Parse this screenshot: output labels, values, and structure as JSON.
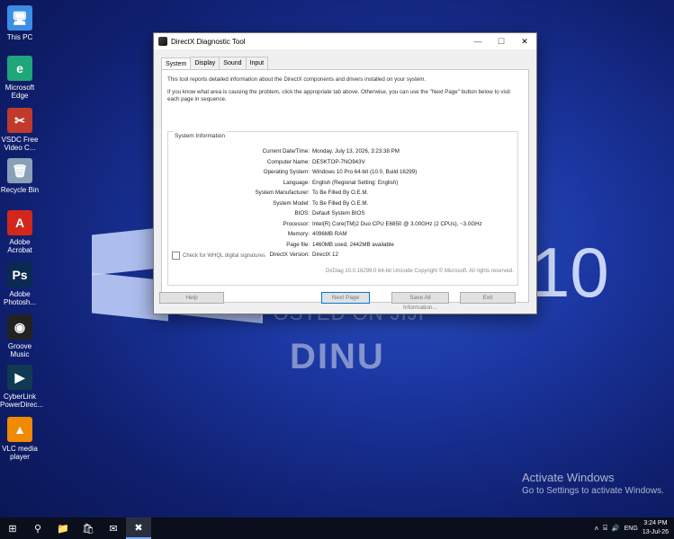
{
  "desktop": {
    "icons": [
      {
        "label": "This PC",
        "icon": "computer-icon",
        "glyph": "🖥",
        "color": "#3a8ee6"
      },
      {
        "label": "Microsoft Edge",
        "icon": "edge-icon",
        "glyph": "e",
        "color": "#1fa67a"
      },
      {
        "label": "VSDC Free Video C...",
        "icon": "vsdc-icon",
        "glyph": "✂",
        "color": "#c0392b"
      },
      {
        "label": "Recycle Bin",
        "icon": "recycle-bin-icon",
        "glyph": "🗑",
        "color": "#8aa0b8"
      },
      {
        "label": "Adobe Acrobat",
        "icon": "acrobat-icon",
        "glyph": "A",
        "color": "#d4271c"
      },
      {
        "label": "Adobe Photosh...",
        "icon": "photoshop-icon",
        "glyph": "Ps",
        "color": "#0a2a52"
      },
      {
        "label": "Groove Music",
        "icon": "groove-music-icon",
        "glyph": "◉",
        "color": "#222222"
      },
      {
        "label": "CyberLink PowerDirec...",
        "icon": "powerdirector-icon",
        "glyph": "▶",
        "color": "#0f3a52"
      },
      {
        "label": "VLC media player",
        "icon": "vlc-icon",
        "glyph": "▲",
        "color": "#f08a00"
      }
    ],
    "watermark_posted": "POSTED ON JIJI",
    "watermark_name": "DINU",
    "win10_number": "10",
    "activation_title": "Activate Windows",
    "activation_sub": "Go to Settings to activate Windows."
  },
  "window": {
    "title": "DirectX Diagnostic Tool",
    "controls": {
      "minimize": "—",
      "maximize": "☐",
      "close": "✕"
    },
    "tabs": [
      "System",
      "Display",
      "Sound",
      "Input"
    ],
    "intro1": "This tool reports detailed information about the DirectX components and drivers installed on your system.",
    "intro2": "If you know what area is causing the problem, click the appropriate tab above.  Otherwise, you can use the \"Next Page\" button below to visit each page in sequence.",
    "group_label": "System Information",
    "rows": [
      {
        "k": "Current Date/Time:",
        "v": "Monday, July 13, 2026, 3:23:38 PM"
      },
      {
        "k": "Computer Name:",
        "v": "DESKTOP-7NO943V"
      },
      {
        "k": "Operating System:",
        "v": "Windows 10 Pro 64-bit (10.0, Build 16299)"
      },
      {
        "k": "Language:",
        "v": "English (Regional Setting: English)"
      },
      {
        "k": "System Manufacturer:",
        "v": "To Be Filled By O.E.M."
      },
      {
        "k": "System Model:",
        "v": "To Be Filled By O.E.M."
      },
      {
        "k": "BIOS:",
        "v": "Default System BIOS"
      },
      {
        "k": "Processor:",
        "v": "Intel(R) Core(TM)2 Duo CPU     E6850  @ 3.00GHz (2 CPUs), ~3.0GHz"
      },
      {
        "k": "Memory:",
        "v": "4096MB RAM"
      },
      {
        "k": "Page file:",
        "v": "1460MB used, 2442MB available"
      },
      {
        "k": "DirectX Version:",
        "v": "DirectX 12"
      }
    ],
    "check_label": "Check for WHQL digital signatures",
    "copyright": "DxDiag 10.0.16299.0 64-bit Unicode  Copyright © Microsoft. All rights reserved.",
    "buttons": {
      "help": "Help",
      "next": "Next Page",
      "save": "Save All Information...",
      "exit": "Exit"
    }
  },
  "taskbar": {
    "items": [
      {
        "icon": "start-icon",
        "glyph": "⊞"
      },
      {
        "icon": "search-icon",
        "glyph": "⚲"
      },
      {
        "icon": "file-explorer-icon",
        "glyph": "📁"
      },
      {
        "icon": "store-icon",
        "glyph": "🛍"
      },
      {
        "icon": "mail-icon",
        "glyph": "✉"
      },
      {
        "icon": "dxdiag-icon",
        "glyph": "✖"
      }
    ],
    "tray_glyphs": {
      "chevron": "˄",
      "network": "⌸",
      "volume": "🔊",
      "language": "ENG"
    },
    "time": "3:24 PM",
    "date": "13-Jul-26"
  }
}
